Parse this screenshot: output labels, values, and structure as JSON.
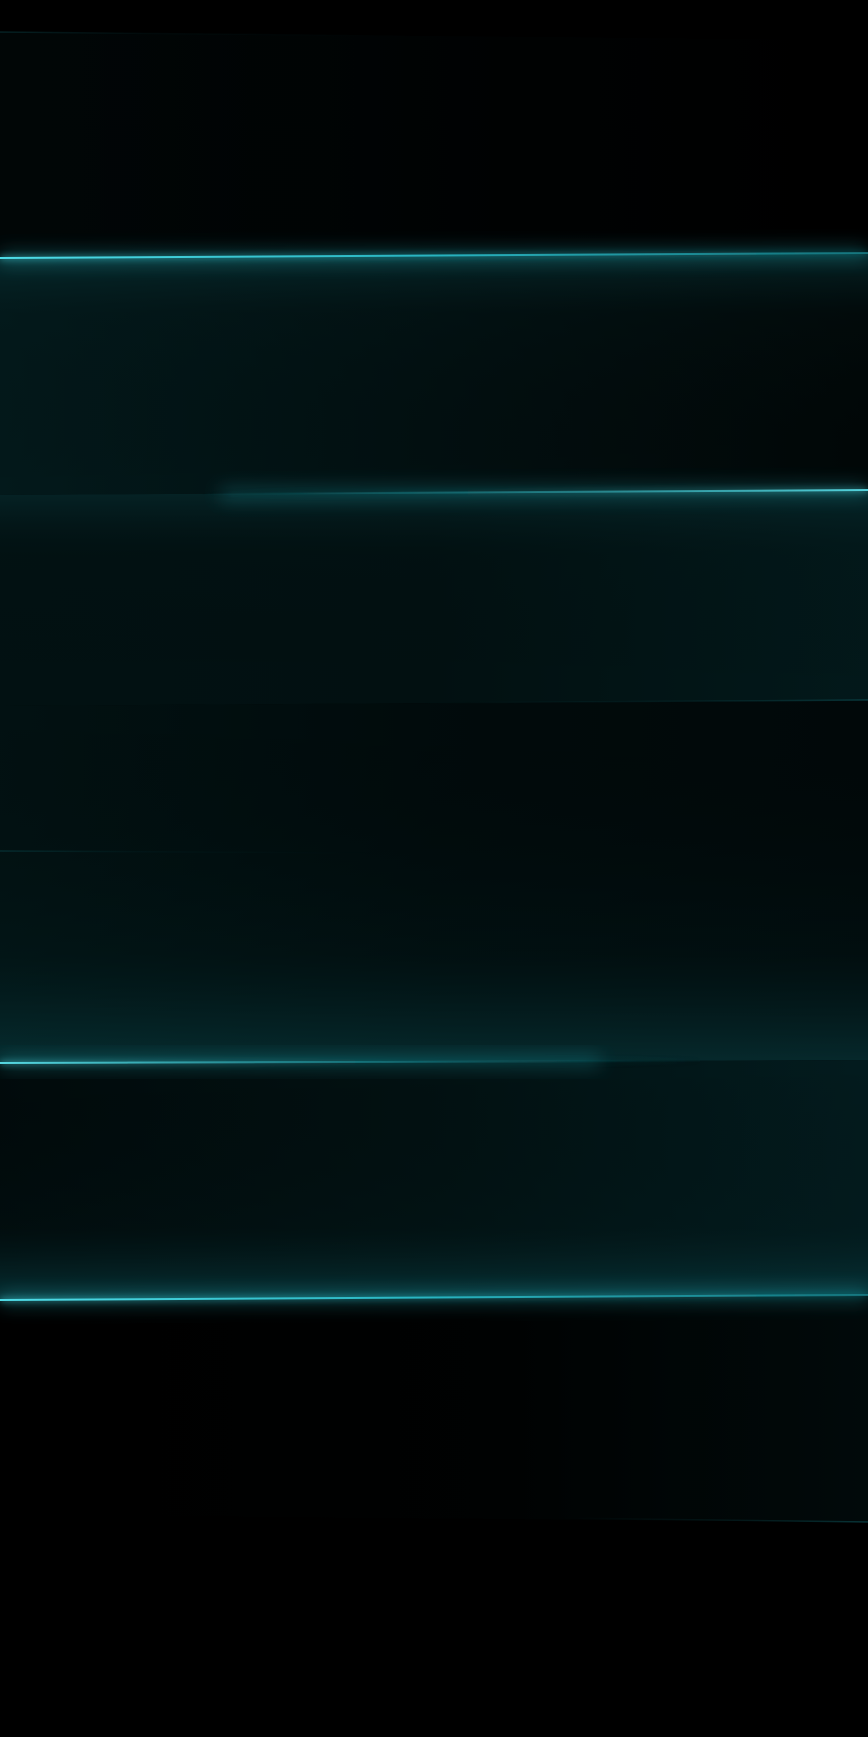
{
  "wallpaper": {
    "description_text": "",
    "palette": {
      "background": "#000000",
      "band_dark": "#01100f",
      "band_mid": "#021a1b",
      "glow": "#0a4a50",
      "line_bright": "#5ee8f2",
      "line_core": "#2cc9d6",
      "line_dim": "#0d5a61"
    },
    "bands": [
      {
        "name": "top-faint-band",
        "intensity": 0.25
      },
      {
        "name": "upper-glass-pane",
        "intensity": 0.9
      },
      {
        "name": "middle-glass-pane",
        "intensity": 0.75
      },
      {
        "name": "center-glass-pane",
        "intensity": 0.55
      },
      {
        "name": "lower-glass-pane",
        "intensity": 0.85
      },
      {
        "name": "bottom-faint-band",
        "intensity": 0.3
      }
    ],
    "edge_lines": [
      {
        "name": "edge-line-top-faint",
        "intensity": 0.18
      },
      {
        "name": "edge-line-upper-bright",
        "intensity": 1.0
      },
      {
        "name": "edge-line-middle",
        "intensity": 0.8
      },
      {
        "name": "edge-line-center-faint",
        "intensity": 0.25
      },
      {
        "name": "edge-line-center-left-faint",
        "intensity": 0.2
      },
      {
        "name": "edge-line-lower",
        "intensity": 0.85
      },
      {
        "name": "edge-line-lower-bright",
        "intensity": 1.0
      },
      {
        "name": "edge-line-bottom-faint",
        "intensity": 0.3
      }
    ]
  }
}
